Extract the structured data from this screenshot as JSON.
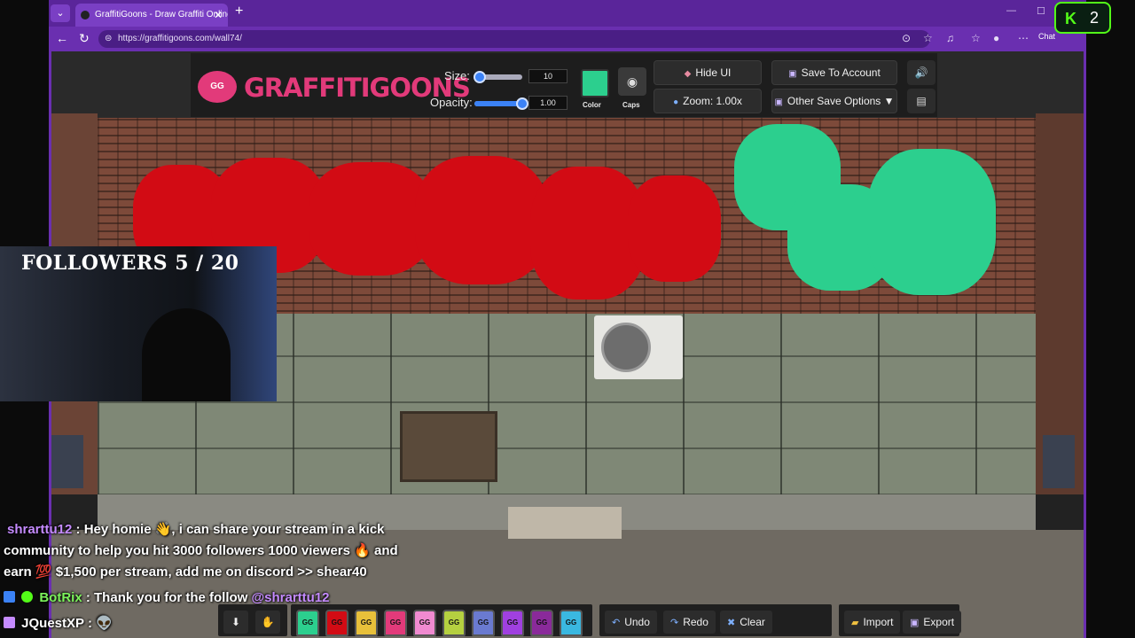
{
  "browser": {
    "tab_title": "GraffitiGoons - Draw Graffiti Online",
    "tab_close": "✕",
    "new_tab": "+",
    "url": "https://graffitigoons.com/wall74/",
    "chat_label": "Chat"
  },
  "app": {
    "logo_badge": "GG",
    "logo_text": "GRAFFITIGOONS",
    "size_label": "Size:",
    "size_value": "10",
    "size_level": 0.12,
    "opacity_label": "Opacity:",
    "opacity_value": "1.00",
    "opacity_level": 1.0,
    "color_label": "Color",
    "caps_label": "Caps",
    "hide_ui_label": "Hide UI",
    "zoom_label": "Zoom: 1.00x",
    "save_account_label": "Save To Account",
    "other_save_label": "Other Save Options ▼",
    "selected_color": "#2ccf8e"
  },
  "bottom": {
    "undo_label": "Undo",
    "redo_label": "Redo",
    "clear_label": "Clear",
    "import_label": "Import",
    "export_label": "Export",
    "can_label": "GG",
    "cans": [
      "#2ccf8e",
      "#d20b14",
      "#e8c03a",
      "#e23a7a",
      "#f08ad0",
      "#b5d040",
      "#6a7ad0",
      "#a040e0",
      "#8a2a9a",
      "#3ab8e0"
    ]
  },
  "stream": {
    "followers": "FOLLOWERS 5 / 20",
    "kick_count": "2",
    "chat": [
      {
        "user": "shrarttu12",
        "text": ": Hey homie 👋, i can share your stream in a kick"
      },
      {
        "user": "",
        "text": "community to help you hit 3000 followers 1000 viewers 🔥 and"
      },
      {
        "user": "",
        "text": "earn 💯 $1,500 per stream, add me on discord >> shear40"
      },
      {
        "user": "BotRix",
        "text": ": Thank you for the follow",
        "mention": "@shrarttu12"
      },
      {
        "user": "JQuestXP",
        "text": ": 👽"
      }
    ]
  }
}
